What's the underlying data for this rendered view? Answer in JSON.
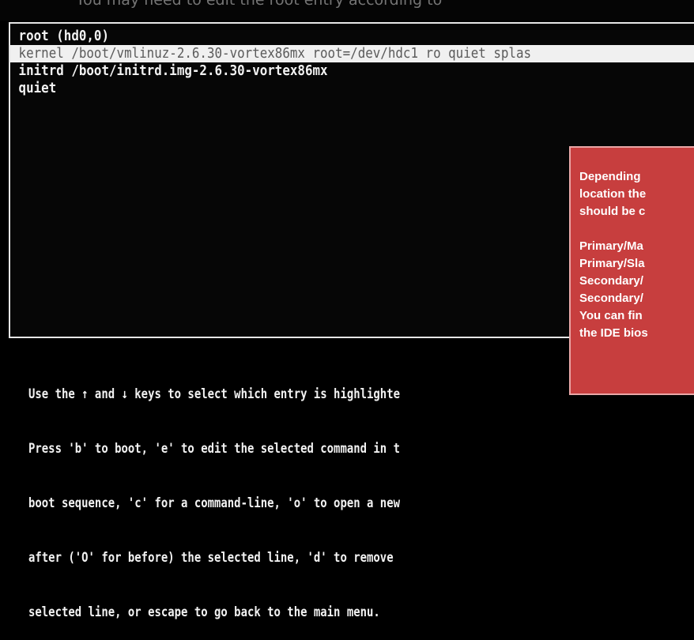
{
  "top_caption": "You may need to edit the root entry according to",
  "grub": {
    "entries": [
      {
        "text": "root (hd0,0)",
        "selected": false
      },
      {
        "text": "kernel   /boot/vmlinuz-2.6.30-vortex86mx root=/dev/hdc1 ro quiet splas",
        "selected": true
      },
      {
        "text": "initrd  /boot/initrd.img-2.6.30-vortex86mx",
        "selected": false
      },
      {
        "text": "quiet",
        "selected": false
      }
    ],
    "help_lines": [
      "Use the ↑ and ↓ keys to select which entry is highlighte",
      "Press 'b' to boot, 'e' to edit the selected command in t",
      "boot sequence, 'c' for a command-line, 'o' to open a new",
      "after ('O' for before) the selected line, 'd' to remove",
      "selected line, or escape to go back to the main menu."
    ]
  },
  "note": {
    "paragraph1": [
      "Depending",
      "location the",
      "should be c"
    ],
    "paragraph2": [
      "Primary/Ma",
      "Primary/Sla",
      "Secondary/",
      "Secondary/",
      "You can fin",
      "the IDE bios"
    ],
    "colors": {
      "background": "#c73e3e",
      "text": "#ffffff"
    }
  }
}
